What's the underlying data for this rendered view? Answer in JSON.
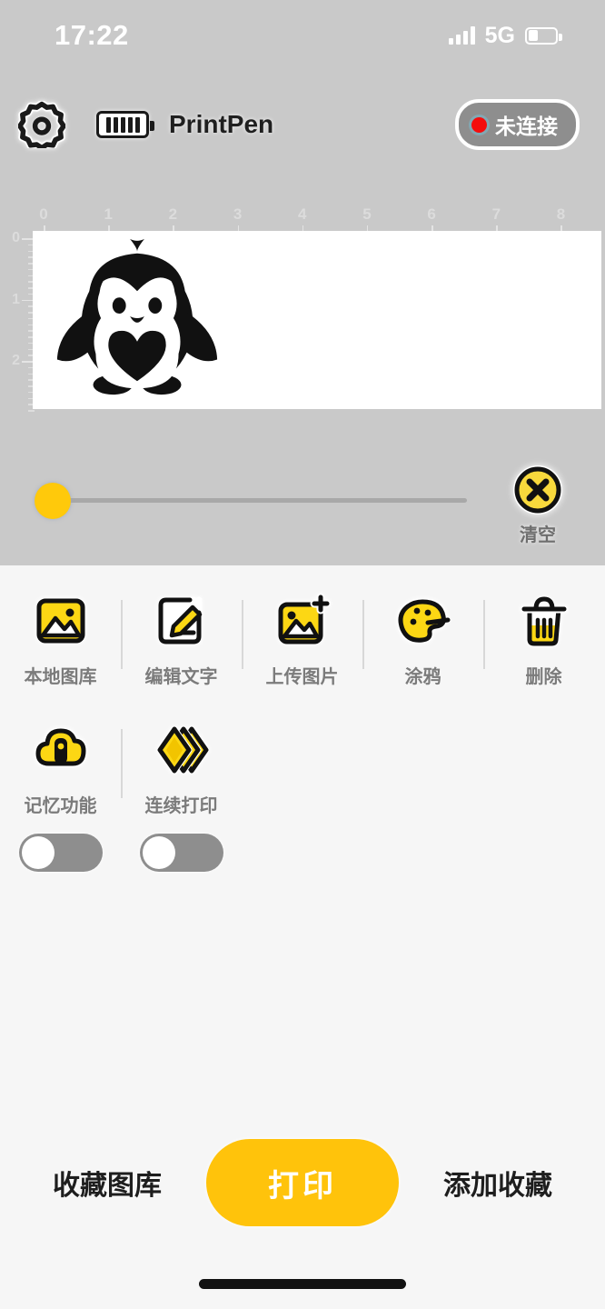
{
  "status_bar": {
    "time": "17:22",
    "network": "5G",
    "signal_icon": "signal-bars-icon",
    "battery_icon": "battery-icon",
    "battery_level_pct": 34
  },
  "app_header": {
    "settings_icon": "gear-icon",
    "device_battery_icon": "device-battery-icon",
    "device_name": "PrintPen",
    "connection": {
      "label": "未连接",
      "dot_color": "#f40d0d",
      "badge_bg": "#8e8e8e"
    }
  },
  "canvas": {
    "ruler_h_labels": [
      "0",
      "1",
      "2",
      "3",
      "4",
      "5",
      "6",
      "7",
      "8"
    ],
    "ruler_v_labels": [
      "0",
      "1",
      "2"
    ],
    "sticker_name": "penguin-sticker",
    "sheet_bg": "#ffffff"
  },
  "slider": {
    "name": "density-slider",
    "value": 0,
    "min": 0,
    "max": 100,
    "thumb_color": "#ffc90b",
    "track_color": "#a8a8a8"
  },
  "clear_action": {
    "icon": "clear-circle-x-icon",
    "label": "清空"
  },
  "tools": {
    "row1": [
      {
        "icon": "local-gallery-icon",
        "label": "本地图库"
      },
      {
        "icon": "edit-text-icon",
        "label": "编辑文字"
      },
      {
        "icon": "upload-image-icon",
        "label": "上传图片"
      },
      {
        "icon": "doodle-palette-icon",
        "label": "涂鸦"
      },
      {
        "icon": "trash-icon",
        "label": "删除"
      }
    ],
    "row2": [
      {
        "icon": "memory-function-icon",
        "label": "记忆功能",
        "toggle_on": false
      },
      {
        "icon": "continuous-print-icon",
        "label": "连续打印",
        "toggle_on": false
      }
    ]
  },
  "action_bar": {
    "favorites_label": "收藏图库",
    "print_label": "打印",
    "add_favorite_label": "添加收藏",
    "print_button_color": "#ffc30b"
  },
  "theme": {
    "accent": "#ffc30b",
    "top_bg": "#c9c9c9",
    "sheet_bg": "#f6f6f6",
    "ink": "#1a1a1a"
  }
}
